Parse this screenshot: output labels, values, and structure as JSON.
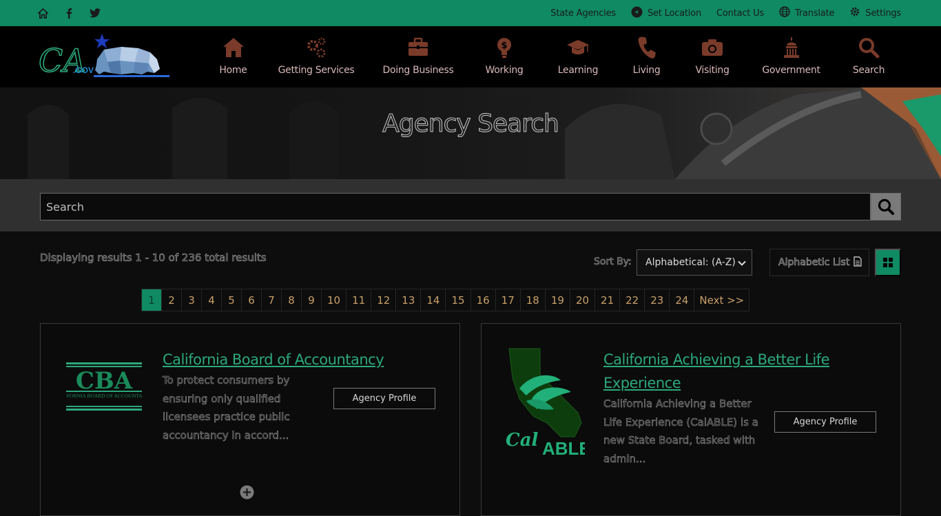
{
  "utility": {
    "links": [
      {
        "label": "State Agencies",
        "icon": ""
      },
      {
        "label": "Set Location",
        "icon": "location-icon"
      },
      {
        "label": "Contact Us",
        "icon": ""
      },
      {
        "label": "Translate",
        "icon": "globe-icon"
      },
      {
        "label": "Settings",
        "icon": "gear-icon"
      }
    ],
    "social_icons": [
      "home-icon",
      "facebook-icon",
      "twitter-icon"
    ]
  },
  "header": {
    "logo_alt": "CA.GOV",
    "logo_text_ca": "CA",
    "logo_text_gov": ".GOV",
    "nav": [
      {
        "label": "Home",
        "icon": "house-icon"
      },
      {
        "label": "Getting Services",
        "icon": "gears-icon"
      },
      {
        "label": "Doing Business",
        "icon": "briefcase-icon"
      },
      {
        "label": "Working",
        "icon": "lightbulb-dollar-icon"
      },
      {
        "label": "Learning",
        "icon": "graduation-cap-icon"
      },
      {
        "label": "Living",
        "icon": "phone-icon"
      },
      {
        "label": "Visiting",
        "icon": "camera-icon"
      },
      {
        "label": "Government",
        "icon": "capitol-icon"
      },
      {
        "label": "Search",
        "icon": "search-icon"
      }
    ]
  },
  "hero": {
    "title": "Agency Search"
  },
  "search": {
    "placeholder": "Search"
  },
  "results": {
    "summary": "Displaying results 1 - 10 of 236 total results",
    "sort_label": "Sort By:",
    "sort_value": "Alphabetical: (A-Z)",
    "alpha_list_label": "Alphabetic List"
  },
  "pagination": {
    "pages": [
      "1",
      "2",
      "3",
      "4",
      "5",
      "6",
      "7",
      "8",
      "9",
      "10",
      "11",
      "12",
      "13",
      "14",
      "15",
      "16",
      "17",
      "18",
      "19",
      "20",
      "21",
      "22",
      "23",
      "24"
    ],
    "active": "1",
    "next_label": "Next >>"
  },
  "cards": [
    {
      "title": "California Board of Accountancy",
      "description": "To protect consumers by ensuring only qualified licensees practice public accountancy in accord...",
      "button": "Agency Profile",
      "logo_text": "CBA",
      "logo_sub": "CALIFORNIA BOARD OF ACCOUNTANCY"
    },
    {
      "title": "California Achieving a Better Life Experience",
      "description": "California Achieving a Better Life Experience (CalABLE) is a new State Board, tasked with admin...",
      "button": "Agency Profile",
      "logo_text_cal": "Cal",
      "logo_text_able": "ABLE"
    }
  ],
  "colors": {
    "brand_green": "#0f8a63",
    "link_green": "#2ca97c",
    "nav_icon": "#7a3b2a",
    "page_number": "#c9a06a"
  }
}
